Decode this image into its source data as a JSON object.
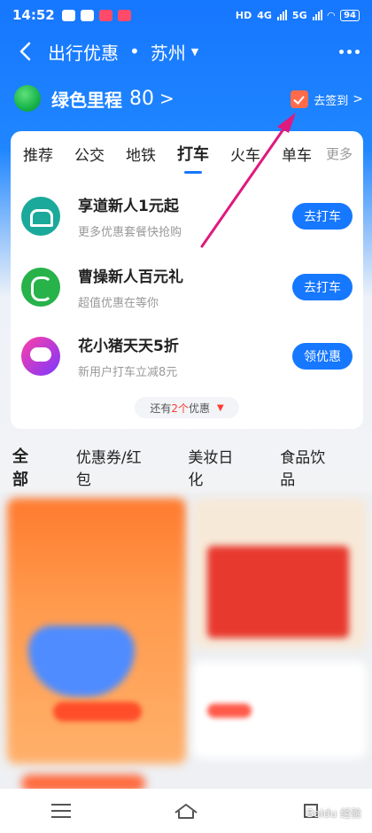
{
  "status_bar": {
    "time": "14:52",
    "network_1": "HD",
    "network_2": "4G",
    "network_3": "5G",
    "battery": "94"
  },
  "navbar": {
    "title": "出行优惠",
    "separator": "•",
    "city": "苏州"
  },
  "mileage": {
    "label": "绿色里程",
    "value": "80",
    "arrow": ">"
  },
  "signin": {
    "label": "去签到",
    "arrow": ">"
  },
  "tabs": [
    {
      "label": "推荐"
    },
    {
      "label": "公交"
    },
    {
      "label": "地铁"
    },
    {
      "label": "打车",
      "active": true
    },
    {
      "label": "火车"
    },
    {
      "label": "单车"
    },
    {
      "label": "更多"
    }
  ],
  "offers": [
    {
      "logo": "xiangdao-logo",
      "title": "享道新人1元起",
      "subtitle": "更多优惠套餐快抢购",
      "button": "去打车"
    },
    {
      "logo": "caocao-logo",
      "title": "曹操新人百元礼",
      "subtitle": "超值优惠在等你",
      "button": "去打车"
    },
    {
      "logo": "huaxiaozhu-logo",
      "title": "花小猪天天5折",
      "subtitle": "新用户打车立减8元",
      "button": "领优惠"
    }
  ],
  "more_offers": {
    "prefix": "还有",
    "count": "2个",
    "suffix": "优惠"
  },
  "categories": [
    {
      "label": "全部",
      "active": true
    },
    {
      "label": "优惠券/红包"
    },
    {
      "label": "美妆日化"
    },
    {
      "label": "食品饮品"
    }
  ],
  "watermark": {
    "text": "Baidu 经验"
  },
  "colors": {
    "primary_blue": "#1677ff",
    "highlight_red": "#ff3b30",
    "annotation_arrow": "#e0197d"
  }
}
